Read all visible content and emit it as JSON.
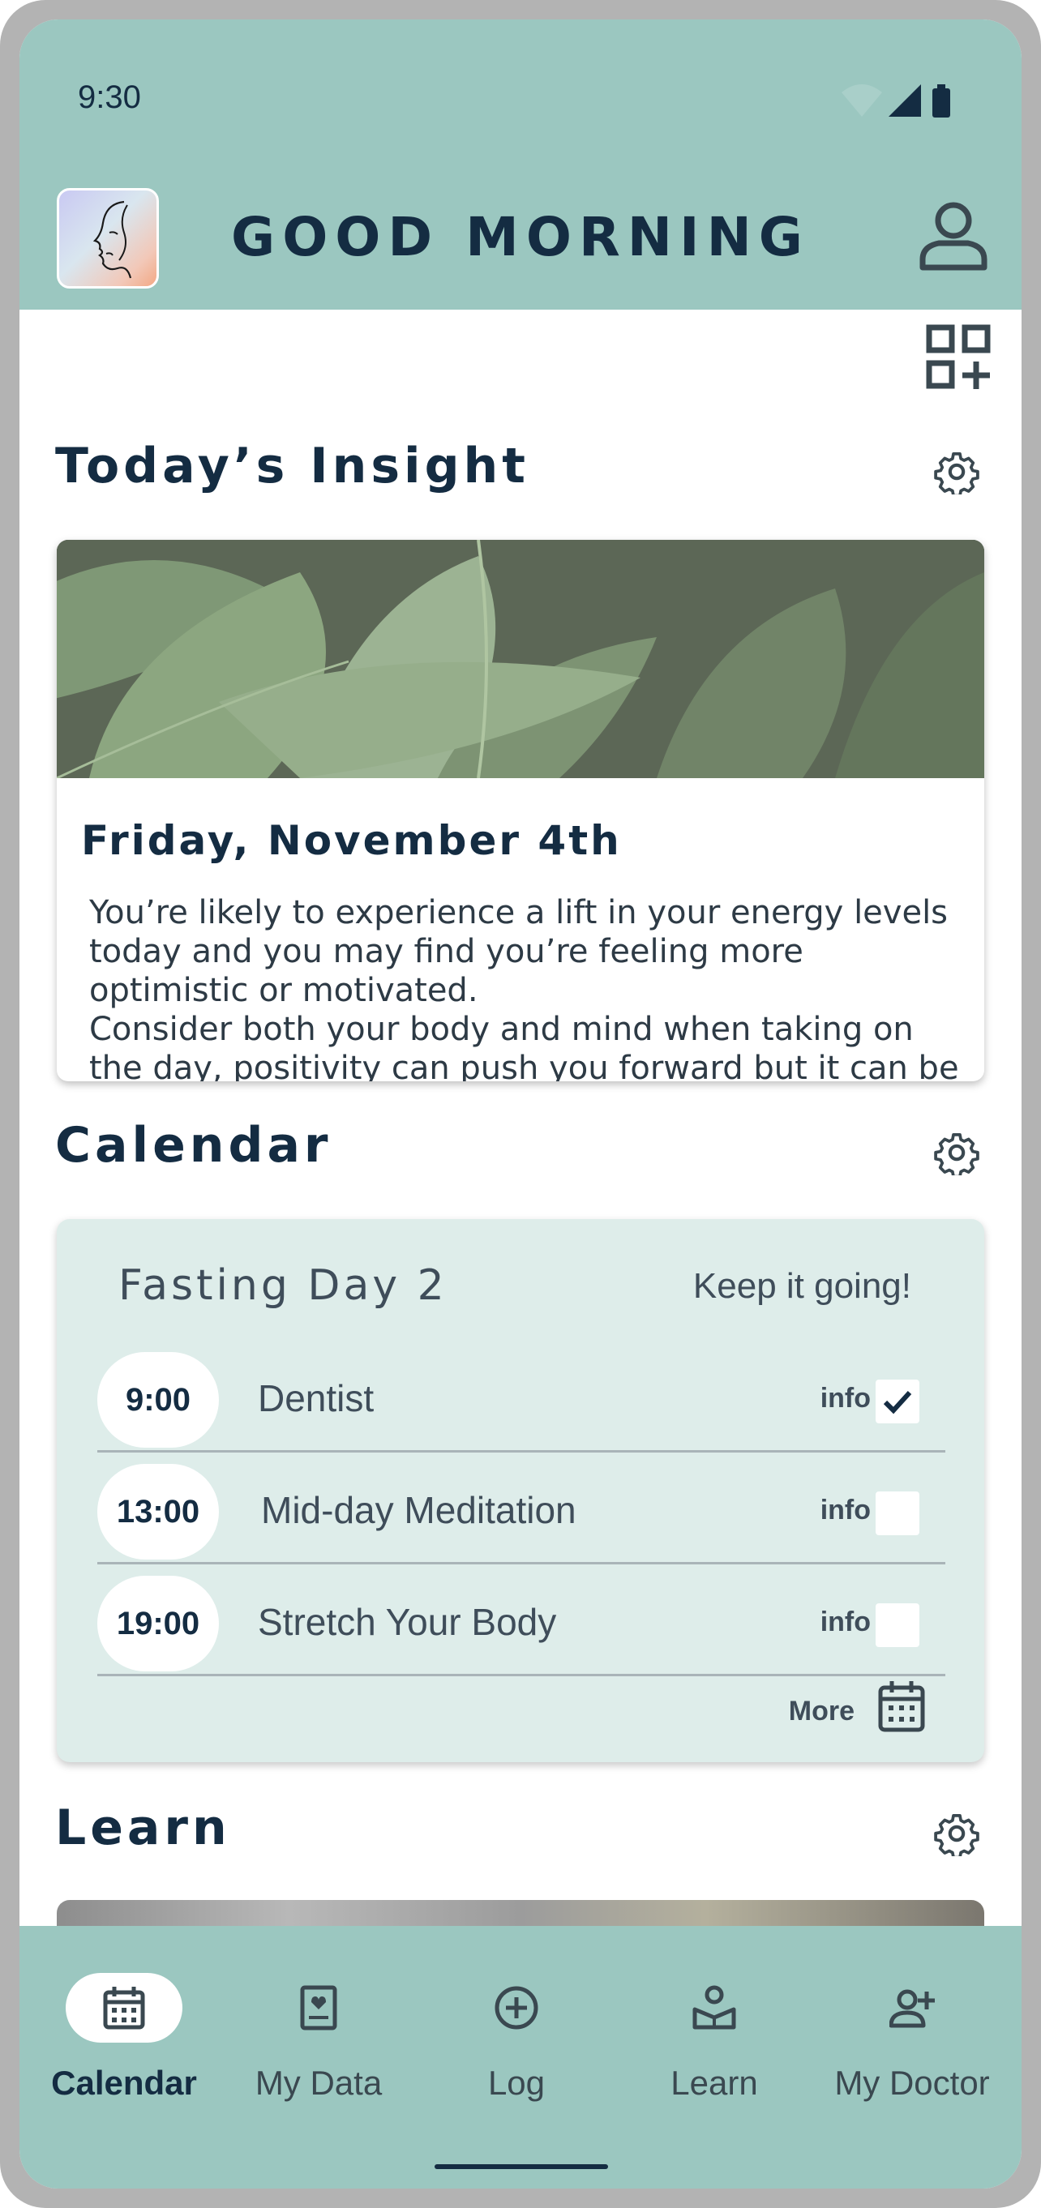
{
  "status_bar": {
    "time": "9:30"
  },
  "header": {
    "title": "GOOD MORNING"
  },
  "insight": {
    "section_title": "Today’s Insight",
    "date": "Friday, November 4th",
    "text_line1": "You’re likely to experience a lift in your energy levels today and you may find you’re feeling more optimistic or motivated.",
    "text_line2": "Consider both your body and mind when taking on the day, positivity can push you forward but it can be"
  },
  "calendar": {
    "section_title": "Calendar",
    "day_label": "Fasting Day 2",
    "motto": "Keep it going!",
    "events": [
      {
        "time": "9:00",
        "label": "Dentist",
        "info": "info",
        "checked": true
      },
      {
        "time": "13:00",
        "label": "Mid-day Meditation",
        "info": "info",
        "checked": false
      },
      {
        "time": "19:00",
        "label": "Stretch Your Body",
        "info": "info",
        "checked": false
      }
    ],
    "more_label": "More"
  },
  "learn": {
    "section_title": "Learn"
  },
  "nav": {
    "items": [
      {
        "label": "Calendar",
        "icon": "calendar-icon",
        "active": true
      },
      {
        "label": "My Data",
        "icon": "data-book-icon",
        "active": false
      },
      {
        "label": "Log",
        "icon": "add-circle-icon",
        "active": false
      },
      {
        "label": "Learn",
        "icon": "learn-icon",
        "active": false
      },
      {
        "label": "My Doctor",
        "icon": "add-person-icon",
        "active": false
      }
    ]
  },
  "colors": {
    "accent": "#9bc7c0",
    "card_tint": "#deedea",
    "text_dark": "#142c42"
  }
}
